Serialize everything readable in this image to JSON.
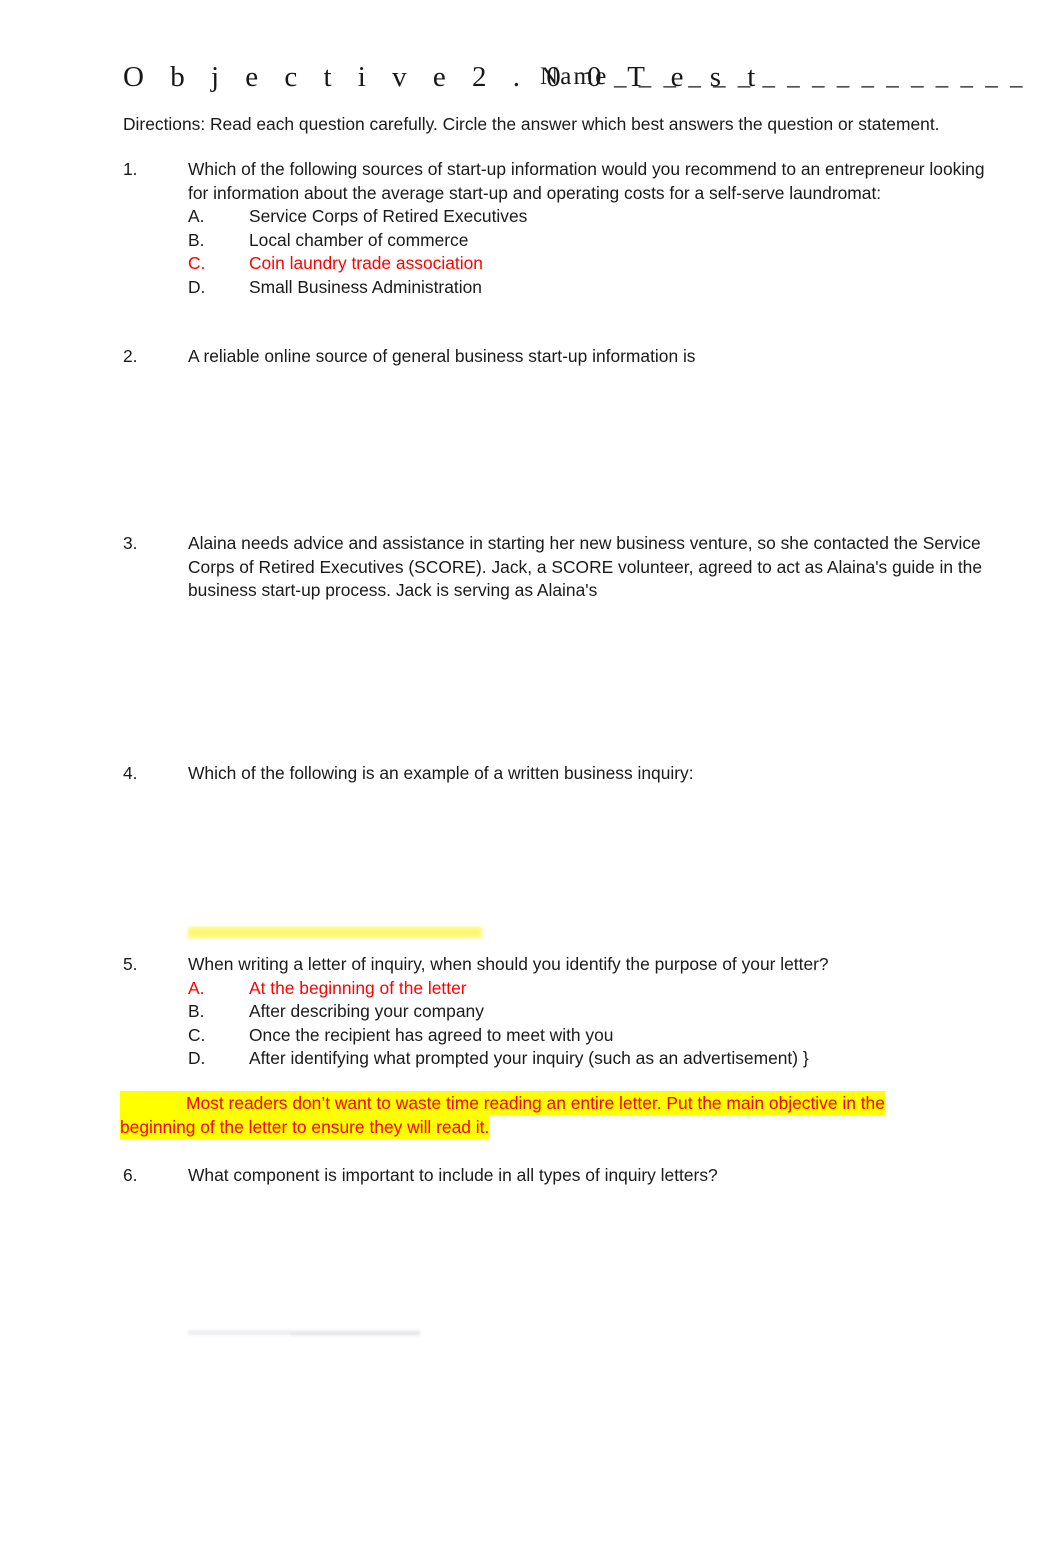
{
  "document": {
    "title": "O b j e c t i v e   2 . 0 0   T e s t",
    "title_plain": "Objective 2.00 Test",
    "name_label": "Name",
    "name_rule": "_ _ _ _ _ _ _ _ _ _ _ _ _ _ _ _ _",
    "directions": "Directions:  Read each question carefully.  Circle the answer which best answers the question or statement.",
    "answer_color": "#FF0000",
    "highlight_color": "#FFFF00"
  },
  "questions": [
    {
      "number": "1.",
      "text": "Which of the following sources of start-up information would you recommend to an entrepreneur looking for information about the average start-up and operating costs for a self-serve laundromat:",
      "options": [
        {
          "letter": "A.",
          "text": "Service Corps of Retired Executives",
          "is_answer": false
        },
        {
          "letter": "B.",
          "text": "Local chamber of commerce",
          "is_answer": false
        },
        {
          "letter": "C.",
          "text": "Coin laundry trade association",
          "is_answer": true
        },
        {
          "letter": "D.",
          "text": "Small Business Administration",
          "is_answer": false
        }
      ]
    },
    {
      "number": "2.",
      "text": "A reliable online source of general business start-up information is",
      "options": []
    },
    {
      "number": "3.",
      "text": "Alaina needs advice and assistance in starting her new business venture, so she contacted the Service Corps of Retired Executives (SCORE). Jack, a SCORE volunteer, agreed to act as Alaina's guide in the business start-up process. Jack is serving as Alaina's",
      "options": []
    },
    {
      "number": "4.",
      "text": "Which of the following is an example of a written business inquiry:",
      "options": []
    },
    {
      "number": "5.",
      "text": "When writing a letter of inquiry, when should you identify the purpose of your letter?",
      "options": [
        {
          "letter": "A.",
          "text": "At the beginning of the letter",
          "is_answer": true
        },
        {
          "letter": "B.",
          "text": "After describing your company",
          "is_answer": false
        },
        {
          "letter": "C.",
          "text": "Once the recipient has agreed to meet with you",
          "is_answer": false
        },
        {
          "letter": "D.",
          "text": "After identifying what prompted your inquiry (such as an advertisement) }",
          "is_answer": false
        }
      ]
    },
    {
      "number": "6.",
      "text": "What component is important to include in all types of inquiry letters?",
      "options": []
    }
  ],
  "explanation": {
    "line1": "Most readers don’t want to waste time reading an entire letter. Put the main objective in the",
    "line2": "beginning of the letter to ensure they will read it."
  }
}
